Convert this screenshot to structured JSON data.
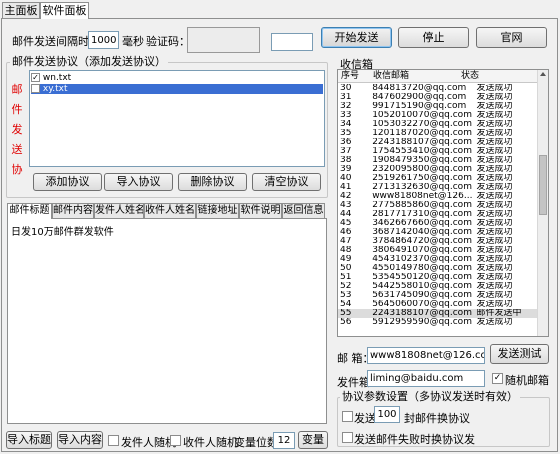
{
  "tabs": [
    "主面板",
    "软件面板"
  ],
  "top": {
    "interval_label": "邮件发送间隔时间",
    "interval_value": "1000",
    "interval_unit": "毫秒",
    "captcha_label": "验证码：",
    "captcha_input": ""
  },
  "buttons": {
    "start": "开始发送",
    "stop": "停止",
    "website": "官网",
    "add_protocol": "添加协议",
    "import_protocol": "导入协议",
    "delete_protocol": "删除协议",
    "clear_protocol": "清空协议",
    "import_title": "导入标题",
    "import_content": "导入内容",
    "variable": "变量",
    "send_test": "发送测试"
  },
  "protocol": {
    "group_title": "邮件发送协议（添加发送协议）",
    "side_label": [
      "邮",
      "件",
      "发",
      "送",
      "协"
    ],
    "items": [
      {
        "label": "wn.txt",
        "checked": true,
        "selected": false
      },
      {
        "label": "xy.txt",
        "checked": false,
        "selected": true
      }
    ]
  },
  "content_tabs": [
    "邮件标题",
    "邮件内容",
    "发件人姓名",
    "收件人姓名",
    "链接地址",
    "软件说明",
    "返回信息"
  ],
  "content_text": "日发10万邮件群发软件",
  "bottom_options": {
    "sender_random": "发件人随机",
    "recipient_random": "收件人随机",
    "var_digits_label": "变量位数",
    "var_digits_value": "12"
  },
  "inbox": {
    "title": "收信箱",
    "columns": [
      "序号",
      "收信邮箱",
      "状态"
    ],
    "rows": [
      [
        "30",
        "844813720@qq.com",
        "发送成功"
      ],
      [
        "31",
        "847602900@qq.com",
        "发送成功"
      ],
      [
        "32",
        "991715190@qq.com",
        "发送成功"
      ],
      [
        "33",
        "1052010070@qq.com",
        "发送成功"
      ],
      [
        "34",
        "1053032270@qq.com",
        "发送成功"
      ],
      [
        "35",
        "1201187020@qq.com",
        "发送成功"
      ],
      [
        "36",
        "2243188107@qq.com",
        "发送成功"
      ],
      [
        "37",
        "1754553410@qq.com",
        "发送成功"
      ],
      [
        "38",
        "1908479350@qq.com",
        "发送成功"
      ],
      [
        "39",
        "2320095800@qq.com",
        "发送成功"
      ],
      [
        "40",
        "2519261750@qq.com",
        "发送成功"
      ],
      [
        "41",
        "2713132630@qq.com",
        "发送成功"
      ],
      [
        "42",
        "www81808net@126...",
        "发送成功"
      ],
      [
        "43",
        "2775885860@qq.com",
        "发送成功"
      ],
      [
        "44",
        "2817717310@qq.com",
        "发送成功"
      ],
      [
        "45",
        "3462667660@qq.com",
        "发送成功"
      ],
      [
        "46",
        "3687142040@qq.com",
        "发送成功"
      ],
      [
        "47",
        "3784864720@qq.com",
        "发送成功"
      ],
      [
        "48",
        "3806491070@qq.com",
        "发送成功"
      ],
      [
        "49",
        "4543102370@qq.com",
        "发送成功"
      ],
      [
        "50",
        "4550149780@qq.com",
        "发送成功"
      ],
      [
        "51",
        "5354550120@qq.com",
        "发送成功"
      ],
      [
        "52",
        "5442558010@qq.com",
        "发送成功"
      ],
      [
        "53",
        "5631745090@qq.com",
        "发送成功"
      ],
      [
        "54",
        "5645060070@qq.com",
        "发送成功"
      ],
      [
        "55",
        "2243188107@qq.com",
        "邮件发送中"
      ],
      [
        "56",
        "5912959590@qq.com",
        "发送成功"
      ]
    ]
  },
  "mail_box": {
    "label": "邮 箱：",
    "value": "www81808net@126.com"
  },
  "sender": {
    "label": "发件箱：",
    "value": "liming@baidu.com",
    "random_mailbox": "随机邮箱"
  },
  "protocol_settings": {
    "title": "协议参数设置（多协议发送时有效）",
    "send_label": "发送",
    "send_value": "100",
    "send_suffix": "封邮件换协议",
    "fail_label": "发送邮件失败时换协议发"
  }
}
